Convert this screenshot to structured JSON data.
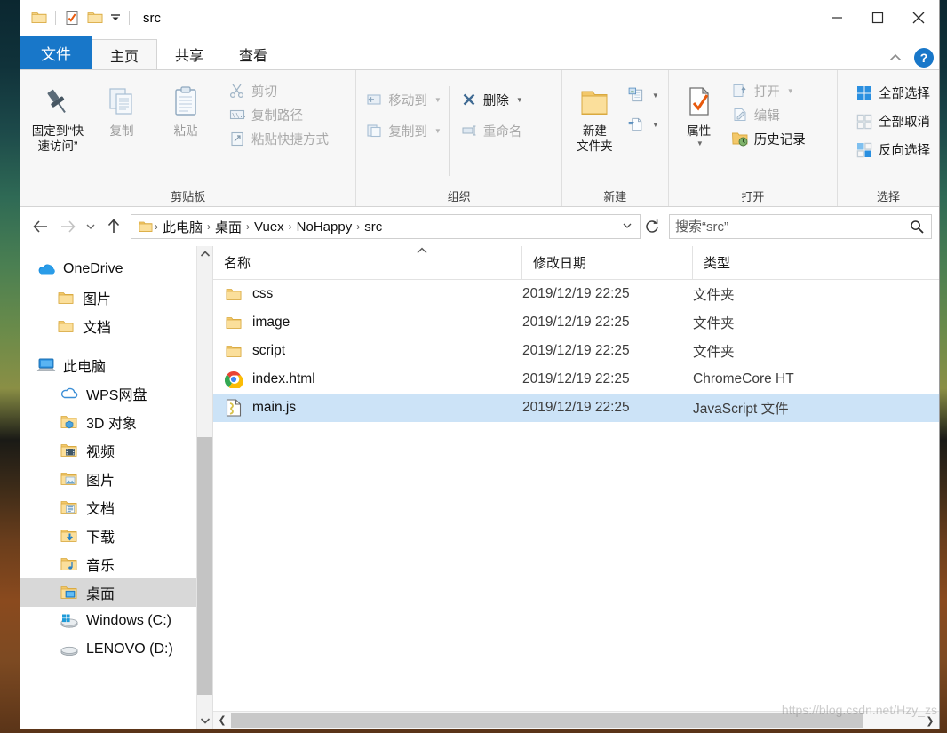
{
  "window": {
    "title": "src",
    "quick_access": [
      {
        "name": "folder-icon",
        "label": "文件夹"
      },
      {
        "name": "properties-icon",
        "label": "属性"
      },
      {
        "name": "new-folder-icon",
        "label": "新建文件夹"
      }
    ],
    "controls": {
      "minimize": "最小化",
      "maximize": "最大化",
      "close": "关闭"
    }
  },
  "tabs": [
    {
      "label": "文件",
      "state": "file"
    },
    {
      "label": "主页",
      "state": "active"
    },
    {
      "label": "共享",
      "state": "normal"
    },
    {
      "label": "查看",
      "state": "normal"
    }
  ],
  "tab_right": {
    "collapse_label": "收起功能区",
    "help_label": "?"
  },
  "ribbon": {
    "groups": [
      {
        "name": "clipboard",
        "label": "剪贴板",
        "big": [
          {
            "label": "固定到“快\n速访问”",
            "icon": "pin-icon",
            "dim": false
          },
          {
            "label": "复制",
            "icon": "copy-icon",
            "dim": true
          },
          {
            "label": "粘贴",
            "icon": "paste-icon",
            "dim": true
          }
        ],
        "small": [
          {
            "label": "剪切",
            "icon": "scissors-icon",
            "dim": true,
            "caret": false
          },
          {
            "label": "复制路径",
            "icon": "copy-path-icon",
            "dim": true,
            "caret": false
          },
          {
            "label": "粘贴快捷方式",
            "icon": "paste-shortcut-icon",
            "dim": true,
            "caret": false
          }
        ]
      },
      {
        "name": "organize",
        "label": "组织",
        "small_a": [
          {
            "label": "移动到",
            "icon": "move-to-icon",
            "dim": true,
            "caret": true
          },
          {
            "label": "复制到",
            "icon": "copy-to-icon",
            "dim": true,
            "caret": true
          }
        ],
        "small_b": [
          {
            "label": "删除",
            "icon": "delete-icon",
            "dim": false,
            "caret": true
          },
          {
            "label": "重命名",
            "icon": "rename-icon",
            "dim": true,
            "caret": false
          }
        ]
      },
      {
        "name": "new",
        "label": "新建",
        "big": [
          {
            "label": "新建\n文件夹",
            "icon": "new-folder-icon",
            "dim": false
          }
        ],
        "small": [
          {
            "label": "",
            "icon": "new-item-icon",
            "dim": false,
            "caret": true
          },
          {
            "label": "",
            "icon": "easy-access-icon",
            "dim": false,
            "caret": true
          }
        ]
      },
      {
        "name": "open",
        "label": "打开",
        "big": [
          {
            "label": "属性",
            "icon": "properties-icon",
            "dim": false,
            "split": true
          }
        ],
        "small": [
          {
            "label": "打开",
            "icon": "open-icon",
            "dim": true,
            "caret": true
          },
          {
            "label": "编辑",
            "icon": "edit-icon",
            "dim": true,
            "caret": false
          },
          {
            "label": "历史记录",
            "icon": "history-icon",
            "dim": false,
            "caret": false
          }
        ]
      },
      {
        "name": "select",
        "label": "选择",
        "small": [
          {
            "label": "全部选择",
            "icon": "select-all-icon",
            "dim": false,
            "caret": false
          },
          {
            "label": "全部取消",
            "icon": "select-none-icon",
            "dim": false,
            "caret": false
          },
          {
            "label": "反向选择",
            "icon": "invert-selection-icon",
            "dim": false,
            "caret": false
          }
        ]
      }
    ]
  },
  "addressbar": {
    "back_label": "后退",
    "forward_label": "前进",
    "recent_label": "最近位置",
    "up_label": "上一级",
    "breadcrumbs": [
      "此电脑",
      "桌面",
      "Vuex",
      "NoHappy",
      "src"
    ],
    "separator": "›",
    "refresh_label": "刷新"
  },
  "search": {
    "placeholder": "搜索“src”",
    "value": ""
  },
  "navpane": {
    "items": [
      {
        "label": "OneDrive",
        "icon": "onedrive-icon",
        "indent": 0,
        "selected": false
      },
      {
        "label": "图片",
        "icon": "folder-icon",
        "indent": 1,
        "selected": false
      },
      {
        "label": "文档",
        "icon": "folder-icon",
        "indent": 1,
        "selected": false
      },
      {
        "label": "此电脑",
        "icon": "this-pc-icon",
        "indent": 0,
        "selected": false,
        "gap_before": true
      },
      {
        "label": "WPS网盘",
        "icon": "wps-cloud-icon",
        "indent": 1,
        "selected": false
      },
      {
        "label": "3D 对象",
        "icon": "folder-3d-icon",
        "indent": 1,
        "selected": false
      },
      {
        "label": "视频",
        "icon": "folder-video-icon",
        "indent": 1,
        "selected": false
      },
      {
        "label": "图片",
        "icon": "folder-pictures-icon",
        "indent": 1,
        "selected": false
      },
      {
        "label": "文档",
        "icon": "folder-documents-icon",
        "indent": 1,
        "selected": false
      },
      {
        "label": "下载",
        "icon": "folder-downloads-icon",
        "indent": 1,
        "selected": false
      },
      {
        "label": "音乐",
        "icon": "folder-music-icon",
        "indent": 1,
        "selected": false
      },
      {
        "label": "桌面",
        "icon": "folder-desktop-icon",
        "indent": 1,
        "selected": true
      },
      {
        "label": "Windows (C:)",
        "icon": "windows-drive-icon",
        "indent": 1,
        "selected": false
      },
      {
        "label": "LENOVO (D:)",
        "icon": "drive-icon",
        "indent": 1,
        "selected": false
      }
    ]
  },
  "filelist": {
    "columns": [
      {
        "label": "名称",
        "key": "name",
        "sorted": "asc"
      },
      {
        "label": "修改日期",
        "key": "date",
        "sorted": null
      },
      {
        "label": "类型",
        "key": "type",
        "sorted": null
      }
    ],
    "rows": [
      {
        "name": "css",
        "date": "2019/12/19 22:25",
        "type": "文件夹",
        "icon": "folder-icon",
        "selected": false
      },
      {
        "name": "image",
        "date": "2019/12/19 22:25",
        "type": "文件夹",
        "icon": "folder-icon",
        "selected": false
      },
      {
        "name": "script",
        "date": "2019/12/19 22:25",
        "type": "文件夹",
        "icon": "folder-icon",
        "selected": false
      },
      {
        "name": "index.html",
        "date": "2019/12/19 22:25",
        "type": "ChromeCore HT",
        "icon": "chrome-icon",
        "selected": false
      },
      {
        "name": "main.js",
        "date": "2019/12/19 22:25",
        "type": "JavaScript 文件",
        "icon": "javascript-icon",
        "selected": true
      }
    ]
  },
  "watermark": "https://blog.csdn.net/Hzy_zs",
  "colors": {
    "accent": "#1877c9",
    "selection": "#cce3f7",
    "nav_selection": "#d8d8d8",
    "ribbon_bg": "#f7f7f7",
    "folder_yellow": "#f7d68a"
  }
}
